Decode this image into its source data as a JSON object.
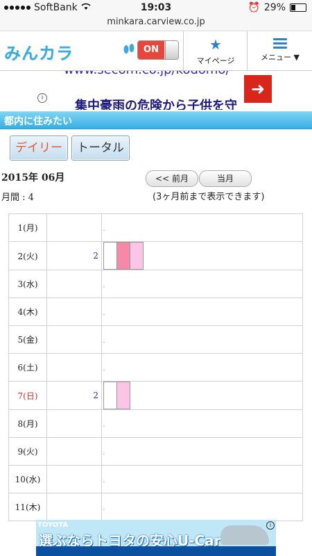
{
  "status_bar": {
    "carrier": "SoftBank",
    "time": "19:03",
    "battery": "29%"
  },
  "url_bar": {
    "domain": "minkara.carview.co.jp"
  },
  "header": {
    "logo": "みんカラ",
    "toggle_label": "ON",
    "mypage_label": "マイページ",
    "menu_label": "メニュー ▼"
  },
  "ad_top": {
    "url_text": "www.secom.co.jp/kodomo/",
    "headline": "集中豪雨の危険から子供を守",
    "arrow": "➜"
  },
  "section": {
    "title": "都内に住みたい"
  },
  "tabs": {
    "daily": "デイリー",
    "total": "トータル"
  },
  "period": {
    "year_month": "2015年 06月",
    "monthly_count": "月間 : 4",
    "prev_button": "<< 前月",
    "current_button": "当月",
    "note": "(3ヶ月前まで表示できます)"
  },
  "calendar": {
    "rows": [
      {
        "day": "1(月)",
        "count": "",
        "segments": []
      },
      {
        "day": "2(火)",
        "count": "2",
        "segments": [
          "white",
          "pink",
          "lpink"
        ]
      },
      {
        "day": "3(水)",
        "count": "",
        "segments": []
      },
      {
        "day": "4(木)",
        "count": "",
        "segments": []
      },
      {
        "day": "5(金)",
        "count": "",
        "segments": []
      },
      {
        "day": "6(土)",
        "count": "",
        "segments": []
      },
      {
        "day": "7(日)",
        "count": "2",
        "segments": [
          "white",
          "lpink"
        ],
        "sunday": true
      },
      {
        "day": "8(月)",
        "count": "",
        "segments": []
      },
      {
        "day": "9(火)",
        "count": "",
        "segments": []
      },
      {
        "day": "10(水)",
        "count": "",
        "segments": []
      },
      {
        "day": "11(木)",
        "count": "",
        "segments": []
      }
    ]
  },
  "ad_bottom": {
    "brand": "TOYOTA",
    "headline": "選ぶならトヨタの安心U-Car"
  },
  "colors": {
    "accent": "#37aee2",
    "sunday": "#d0302a",
    "pink": "#f688aa",
    "light_pink": "#fcc4e6"
  }
}
